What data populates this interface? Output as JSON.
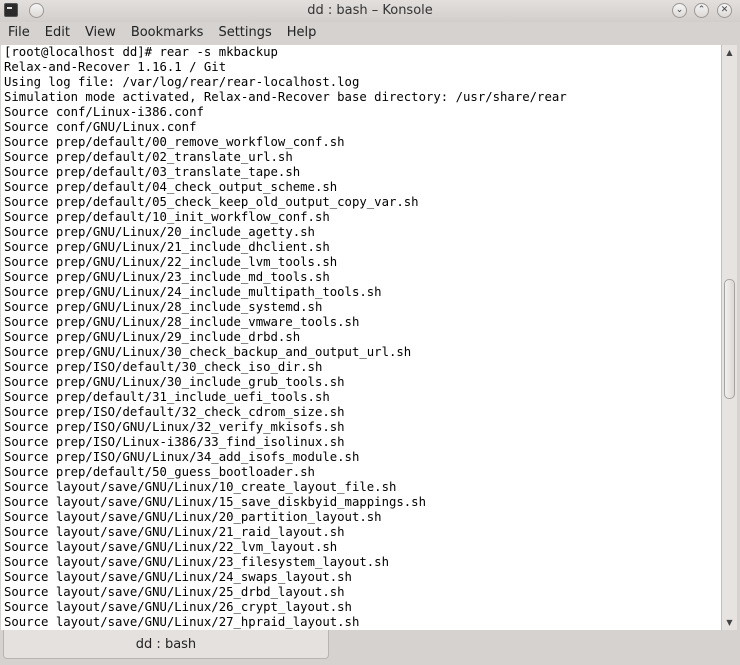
{
  "window": {
    "title": "dd : bash – Konsole",
    "controls": {
      "pin_icon": "pin-icon",
      "minimize_icon": "chevron-down-icon",
      "maximize_icon": "chevron-up-icon",
      "close_icon": "close-icon"
    }
  },
  "menubar": {
    "items": [
      "File",
      "Edit",
      "View",
      "Bookmarks",
      "Settings",
      "Help"
    ]
  },
  "terminal": {
    "lines": [
      "[root@localhost dd]# rear -s mkbackup",
      "Relax-and-Recover 1.16.1 / Git",
      "Using log file: /var/log/rear/rear-localhost.log",
      "Simulation mode activated, Relax-and-Recover base directory: /usr/share/rear",
      "Source conf/Linux-i386.conf",
      "Source conf/GNU/Linux.conf",
      "Source prep/default/00_remove_workflow_conf.sh",
      "Source prep/default/02_translate_url.sh",
      "Source prep/default/03_translate_tape.sh",
      "Source prep/default/04_check_output_scheme.sh",
      "Source prep/default/05_check_keep_old_output_copy_var.sh",
      "Source prep/default/10_init_workflow_conf.sh",
      "Source prep/GNU/Linux/20_include_agetty.sh",
      "Source prep/GNU/Linux/21_include_dhclient.sh",
      "Source prep/GNU/Linux/22_include_lvm_tools.sh",
      "Source prep/GNU/Linux/23_include_md_tools.sh",
      "Source prep/GNU/Linux/24_include_multipath_tools.sh",
      "Source prep/GNU/Linux/28_include_systemd.sh",
      "Source prep/GNU/Linux/28_include_vmware_tools.sh",
      "Source prep/GNU/Linux/29_include_drbd.sh",
      "Source prep/GNU/Linux/30_check_backup_and_output_url.sh",
      "Source prep/ISO/default/30_check_iso_dir.sh",
      "Source prep/GNU/Linux/30_include_grub_tools.sh",
      "Source prep/default/31_include_uefi_tools.sh",
      "Source prep/ISO/default/32_check_cdrom_size.sh",
      "Source prep/ISO/GNU/Linux/32_verify_mkisofs.sh",
      "Source prep/ISO/Linux-i386/33_find_isolinux.sh",
      "Source prep/ISO/GNU/Linux/34_add_isofs_module.sh",
      "Source prep/default/50_guess_bootloader.sh",
      "Source layout/save/GNU/Linux/10_create_layout_file.sh",
      "Source layout/save/GNU/Linux/15_save_diskbyid_mappings.sh",
      "Source layout/save/GNU/Linux/20_partition_layout.sh",
      "Source layout/save/GNU/Linux/21_raid_layout.sh",
      "Source layout/save/GNU/Linux/22_lvm_layout.sh",
      "Source layout/save/GNU/Linux/23_filesystem_layout.sh",
      "Source layout/save/GNU/Linux/24_swaps_layout.sh",
      "Source layout/save/GNU/Linux/25_drbd_layout.sh",
      "Source layout/save/GNU/Linux/26_crypt_layout.sh",
      "Source layout/save/GNU/Linux/27_hpraid_layout.sh"
    ]
  },
  "tabs": [
    {
      "label": "dd : bash"
    }
  ]
}
